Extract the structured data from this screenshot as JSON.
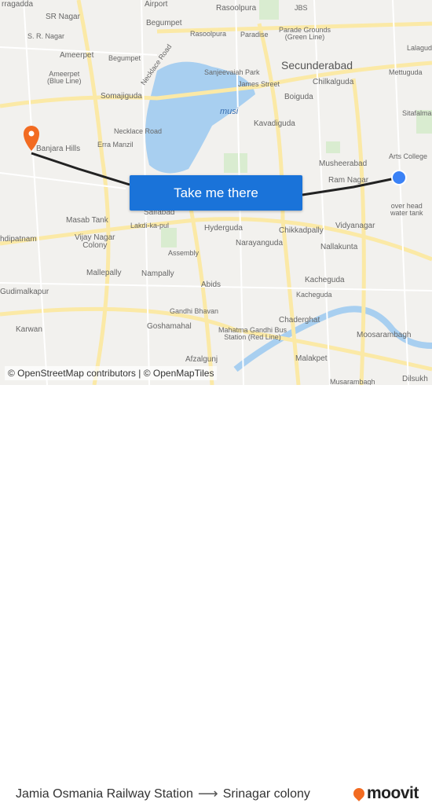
{
  "map": {
    "labels": {
      "airport": "Airport",
      "rasoolpura": "Rasoolpura",
      "jbs": "JBS",
      "sr_nagar": "SR Nagar",
      "begumpet": "Begumpet",
      "sr_nagar2": "S. R. Nagar",
      "rasoolpura2": "Rasoolpura",
      "paradise": "Paradise",
      "parade": "Parade Grounds\n(Green Line)",
      "lalaguda": "Lalagud",
      "ameerpet": "Ameerpet",
      "begumpet2": "Begumpet",
      "necklace_road": "Necklace Road",
      "secunderabad": "Secunderabad",
      "ameerpet_bl": "Ameerpet\n(Blue Line)",
      "sanjeevaiah": "Sanjeevaiah Park",
      "james_street": "James Street",
      "chilkalguda": "Chilkalguda",
      "mettuguda": "Mettuguda",
      "somajiguda": "Somajiguda",
      "boiguda": "Boiguda",
      "musi": "musi",
      "sitafalmandi": "Sitafalmandi",
      "necklace_road2": "Necklace Road",
      "kavadiguda": "Kavadiguda",
      "banjara": "Banjara Hills",
      "erra_manzil": "Erra Manzil",
      "arts_college": "Arts College",
      "musheerabad": "Musheerabad",
      "ram_nagar": "Ram Nagar",
      "overhead": "over head\nwater tank",
      "masab_tank": "Masab Tank",
      "saifabad": "Saifabad",
      "lakdi": "Lakdi-ka-pul",
      "hyderguda": "Hyderguda",
      "chikkadpally": "Chikkadpally",
      "vidyanagar": "Vidyanagar",
      "vijay_nagar": "Vijay Nagar\nColony",
      "assembly": "Assembly",
      "narayanguda": "Narayanguda",
      "nallakunta": "Nallakunta",
      "mehdipatnam": "hdipatnam",
      "mallepally": "Mallepally",
      "nampally": "Nampally",
      "abids": "Abids",
      "kacheguda": "Kacheguda",
      "kacheguda2": "Kacheguda",
      "gudimalkapur": "Gudimalkapur",
      "gandhi_bhavan": "Gandhi Bhavan",
      "karwan": "Karwan",
      "goshamahal": "Goshamahal",
      "chaderghat": "Chaderghat",
      "mgbs": "Mahatma Gandhi Bus\nStation (Red Line)",
      "moosarambagh": "Moosarambagh",
      "malakpet": "Malakpet",
      "afzalgunj": "Afzalgunj",
      "musarambagh": "Musarambagh",
      "dilsukh": "Dilsukh",
      "erragada": "rragadda"
    },
    "button_label": "Take me there",
    "attribution": "© OpenStreetMap contributors | © OpenMapTiles",
    "colors": {
      "route": "#222222",
      "origin_pin": "#f26b21",
      "destination": "#3b82f6",
      "water": "#a8cff0",
      "button": "#1a73d9"
    }
  },
  "footer": {
    "origin": "Jamia Osmania Railway Station",
    "arrow": "⟶",
    "destination": "Srinagar colony",
    "logo": "moovit"
  }
}
